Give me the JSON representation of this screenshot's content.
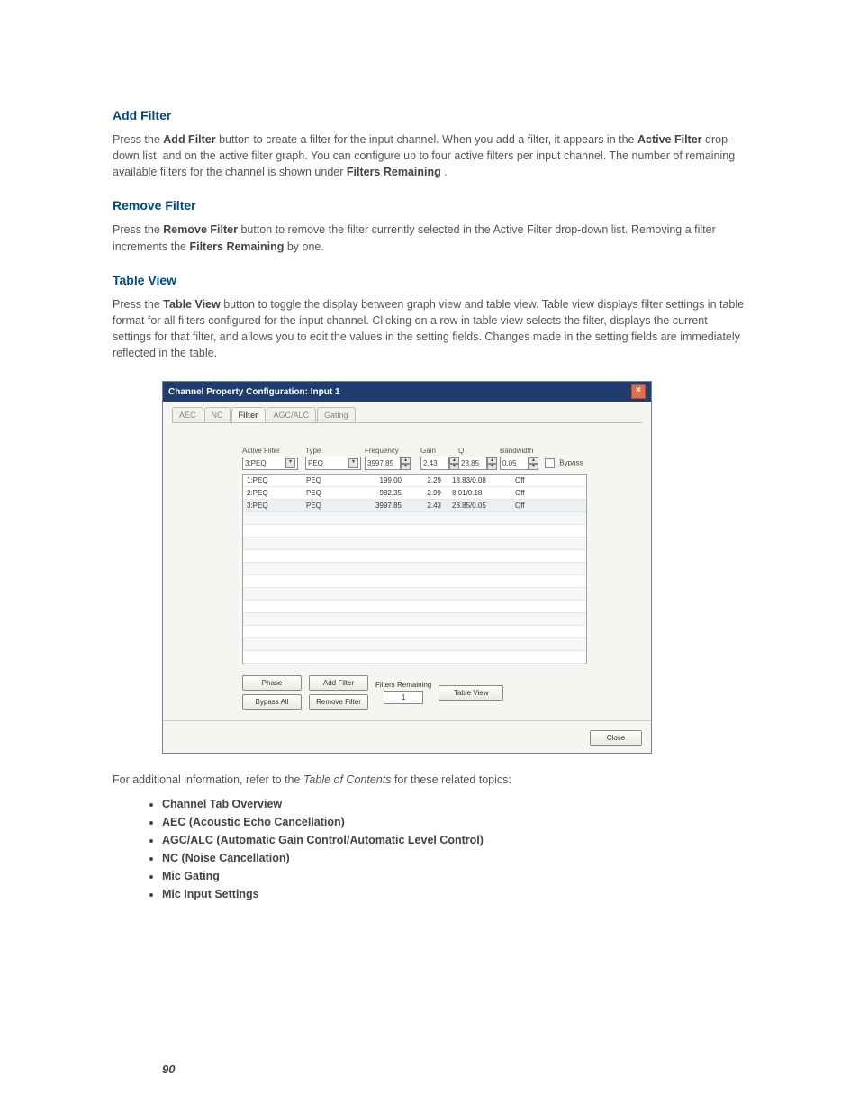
{
  "sections": {
    "add_filter": {
      "title": "Add Filter",
      "p1a": "Press the ",
      "p1b": "Add Filter",
      "p1c": " button to create a filter for the input channel. When you add a filter, it appears in the ",
      "p1d": "Active Filter",
      "p1e": " drop-down list, and on the active filter graph. You can configure up to four active filters per input channel. The number of remaining available filters for the channel is shown under ",
      "p1f": "Filters Remaining",
      "p1g": "."
    },
    "remove_filter": {
      "title": "Remove Filter",
      "p1a": "Press the ",
      "p1b": "Remove Filter",
      "p1c": " button to remove the filter currently selected in the Active Filter drop-down list. Removing a filter increments the ",
      "p1d": "Filters Remaining",
      "p1e": " by one."
    },
    "table_view": {
      "title": "Table View",
      "p1a": "Press the ",
      "p1b": "Table View",
      "p1c": " button to toggle the display between graph view and table view. Table view displays filter settings in table format for all filters configured for the input channel. Clicking on a row in table view selects the filter, displays the current settings for that filter, and allows you to edit the values in the setting fields. Changes made in the setting fields are immediately reflected in the table."
    }
  },
  "window": {
    "title": "Channel Property Configuration: Input 1",
    "close_glyph": "×",
    "tabs": {
      "aec": "AEC",
      "nc": "NC",
      "filter": "Filter",
      "agc": "AGC/ALC",
      "gating": "Gating"
    },
    "labels": {
      "active_filter": "Active Filter",
      "type": "Type",
      "frequency": "Frequency",
      "gain": "Gain",
      "q": "Q",
      "bandwidth": "Bandwidth",
      "bypass": "Bypass"
    },
    "controls": {
      "active_filter_value": "3:PEQ",
      "type_value": "PEQ",
      "frequency_value": "3997.85",
      "gain_value": "2.43",
      "q_value": "28.85",
      "bandwidth_value": "0.05"
    },
    "rows": [
      {
        "name": "1:PEQ",
        "type": "PEQ",
        "freq": "199.00",
        "gain": "2.29",
        "q": "18.83/0.08",
        "bypass": "Off"
      },
      {
        "name": "2:PEQ",
        "type": "PEQ",
        "freq": "982.35",
        "gain": "-2.99",
        "q": "8.01/0.18",
        "bypass": "Off"
      },
      {
        "name": "3:PEQ",
        "type": "PEQ",
        "freq": "3997.85",
        "gain": "2.43",
        "q": "28.85/0.05",
        "bypass": "Off"
      }
    ],
    "buttons": {
      "phase": "Phase",
      "bypass_all": "Bypass All",
      "add_filter": "Add Filter",
      "remove_filter": "Remove Filter",
      "filters_remaining_label": "Filters Remaining",
      "filters_remaining_value": "1",
      "table_view": "Table View",
      "close": "Close"
    }
  },
  "footer": {
    "text_a": "For additional information, refer to the ",
    "text_i": "Table of Contents",
    "text_b": " for these related topics:",
    "topics": [
      "Channel Tab Overview",
      "AEC (Acoustic Echo Cancellation)",
      "AGC/ALC (Automatic Gain Control/Automatic Level Control)",
      "NC (Noise Cancellation)",
      "Mic Gating",
      "Mic Input Settings"
    ]
  },
  "page_number": "90"
}
